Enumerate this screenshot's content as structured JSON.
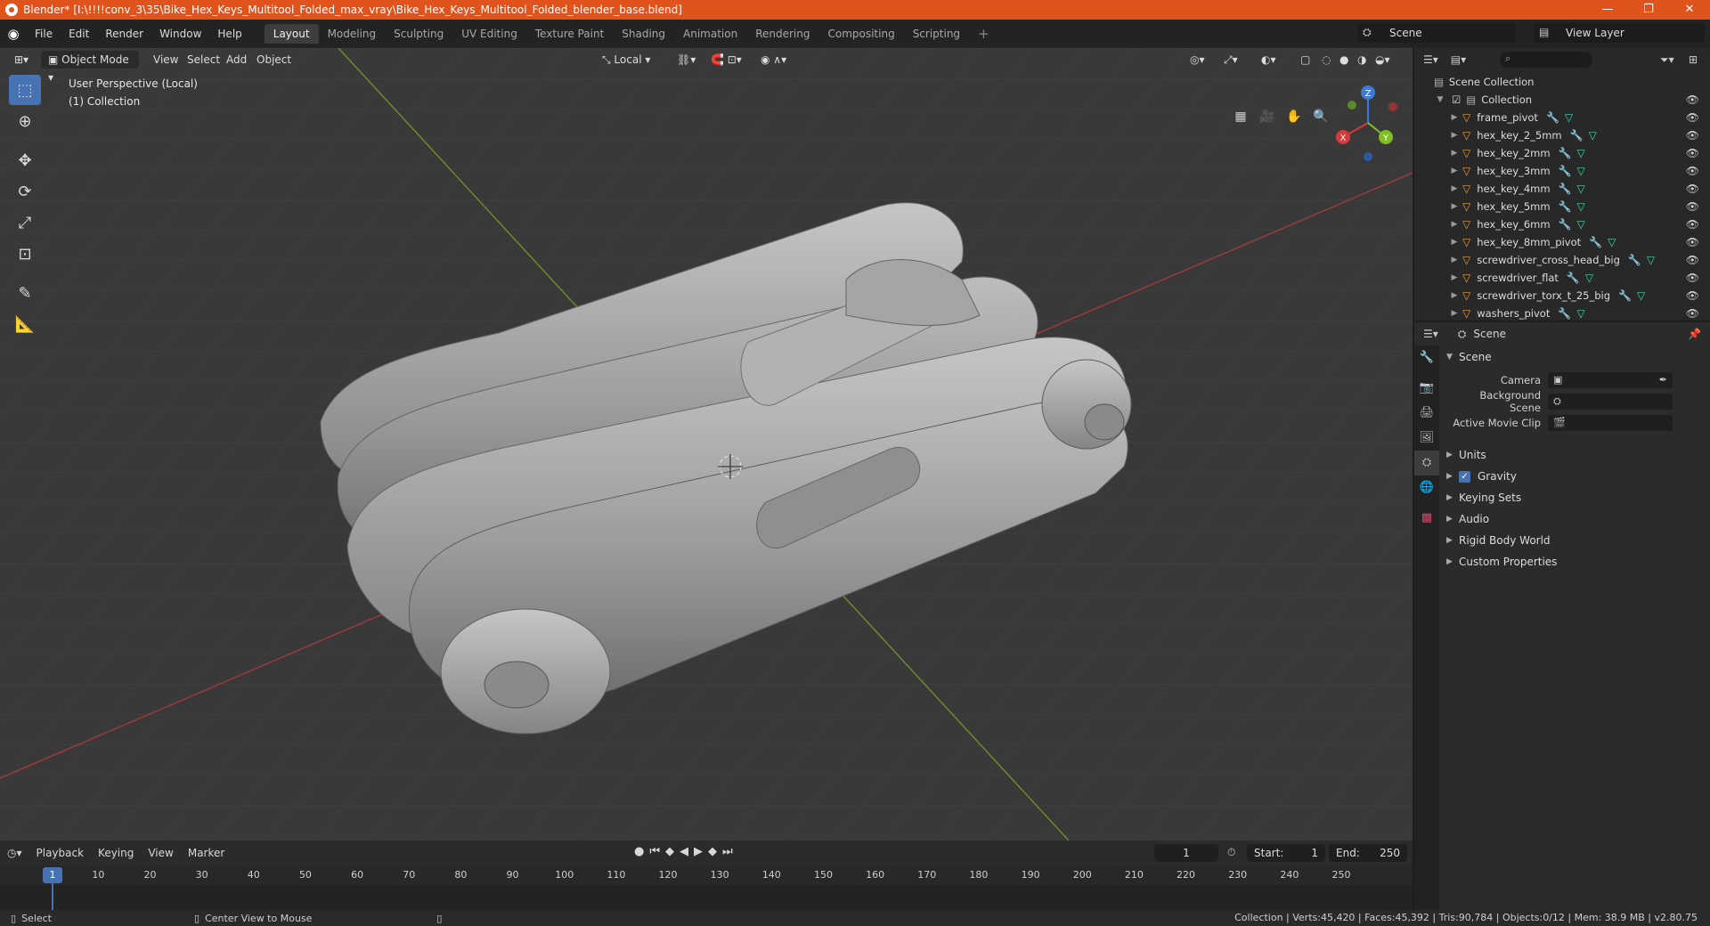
{
  "window": {
    "title": "Blender* [I:\\!!!!conv_3\\35\\Bike_Hex_Keys_Multitool_Folded_max_vray\\Bike_Hex_Keys_Multitool_Folded_blender_base.blend]",
    "minimize": "—",
    "maximize": "❐",
    "close": "✕"
  },
  "menubar": {
    "menus": [
      "File",
      "Edit",
      "Render",
      "Window",
      "Help"
    ],
    "tabs": [
      "Layout",
      "Modeling",
      "Sculpting",
      "UV Editing",
      "Texture Paint",
      "Shading",
      "Animation",
      "Rendering",
      "Compositing",
      "Scripting"
    ],
    "active_tab": "Layout",
    "add_tab": "+",
    "scene": "Scene",
    "view_layer": "View Layer"
  },
  "viewport": {
    "mode": "Object Mode",
    "menus": [
      "View",
      "Select",
      "Add",
      "Object"
    ],
    "orientation": "Local",
    "info_line1": "User Perspective (Local)",
    "info_line2": "(1) Collection",
    "gizmo": {
      "x": "X",
      "y": "Y",
      "z": "Z"
    }
  },
  "timeline": {
    "menus": [
      "Playback",
      "Keying",
      "View",
      "Marker"
    ],
    "current_frame": "1",
    "start_label": "Start:",
    "start": "1",
    "end_label": "End:",
    "end": "250",
    "ruler": [
      "1",
      "10",
      "20",
      "30",
      "40",
      "50",
      "60",
      "70",
      "80",
      "90",
      "100",
      "110",
      "120",
      "130",
      "140",
      "150",
      "160",
      "170",
      "180",
      "190",
      "200",
      "210",
      "220",
      "230",
      "240",
      "250"
    ]
  },
  "statusbar": {
    "select": "Select",
    "center_view": "Center View to Mouse",
    "stats": "Collection | Verts:45,420 | Faces:45,392 | Tris:90,784 | Objects:0/12 | Mem: 38.9 MB | v2.80.75"
  },
  "outliner": {
    "root": "Scene Collection",
    "collection": "Collection",
    "objects": [
      "frame_pivot",
      "hex_key_2_5mm",
      "hex_key_2mm",
      "hex_key_3mm",
      "hex_key_4mm",
      "hex_key_5mm",
      "hex_key_6mm",
      "hex_key_8mm_pivot",
      "screwdriver_cross_head_big",
      "screwdriver_flat",
      "screwdriver_torx_t_25_big",
      "washers_pivot"
    ]
  },
  "properties": {
    "header": "Scene",
    "section": "Scene",
    "camera_label": "Camera",
    "background_label": "Background Scene",
    "movieclip_label": "Active Movie Clip",
    "units": "Units",
    "gravity": "Gravity",
    "keying_sets": "Keying Sets",
    "audio": "Audio",
    "rigid_body": "Rigid Body World",
    "custom_props": "Custom Properties"
  }
}
